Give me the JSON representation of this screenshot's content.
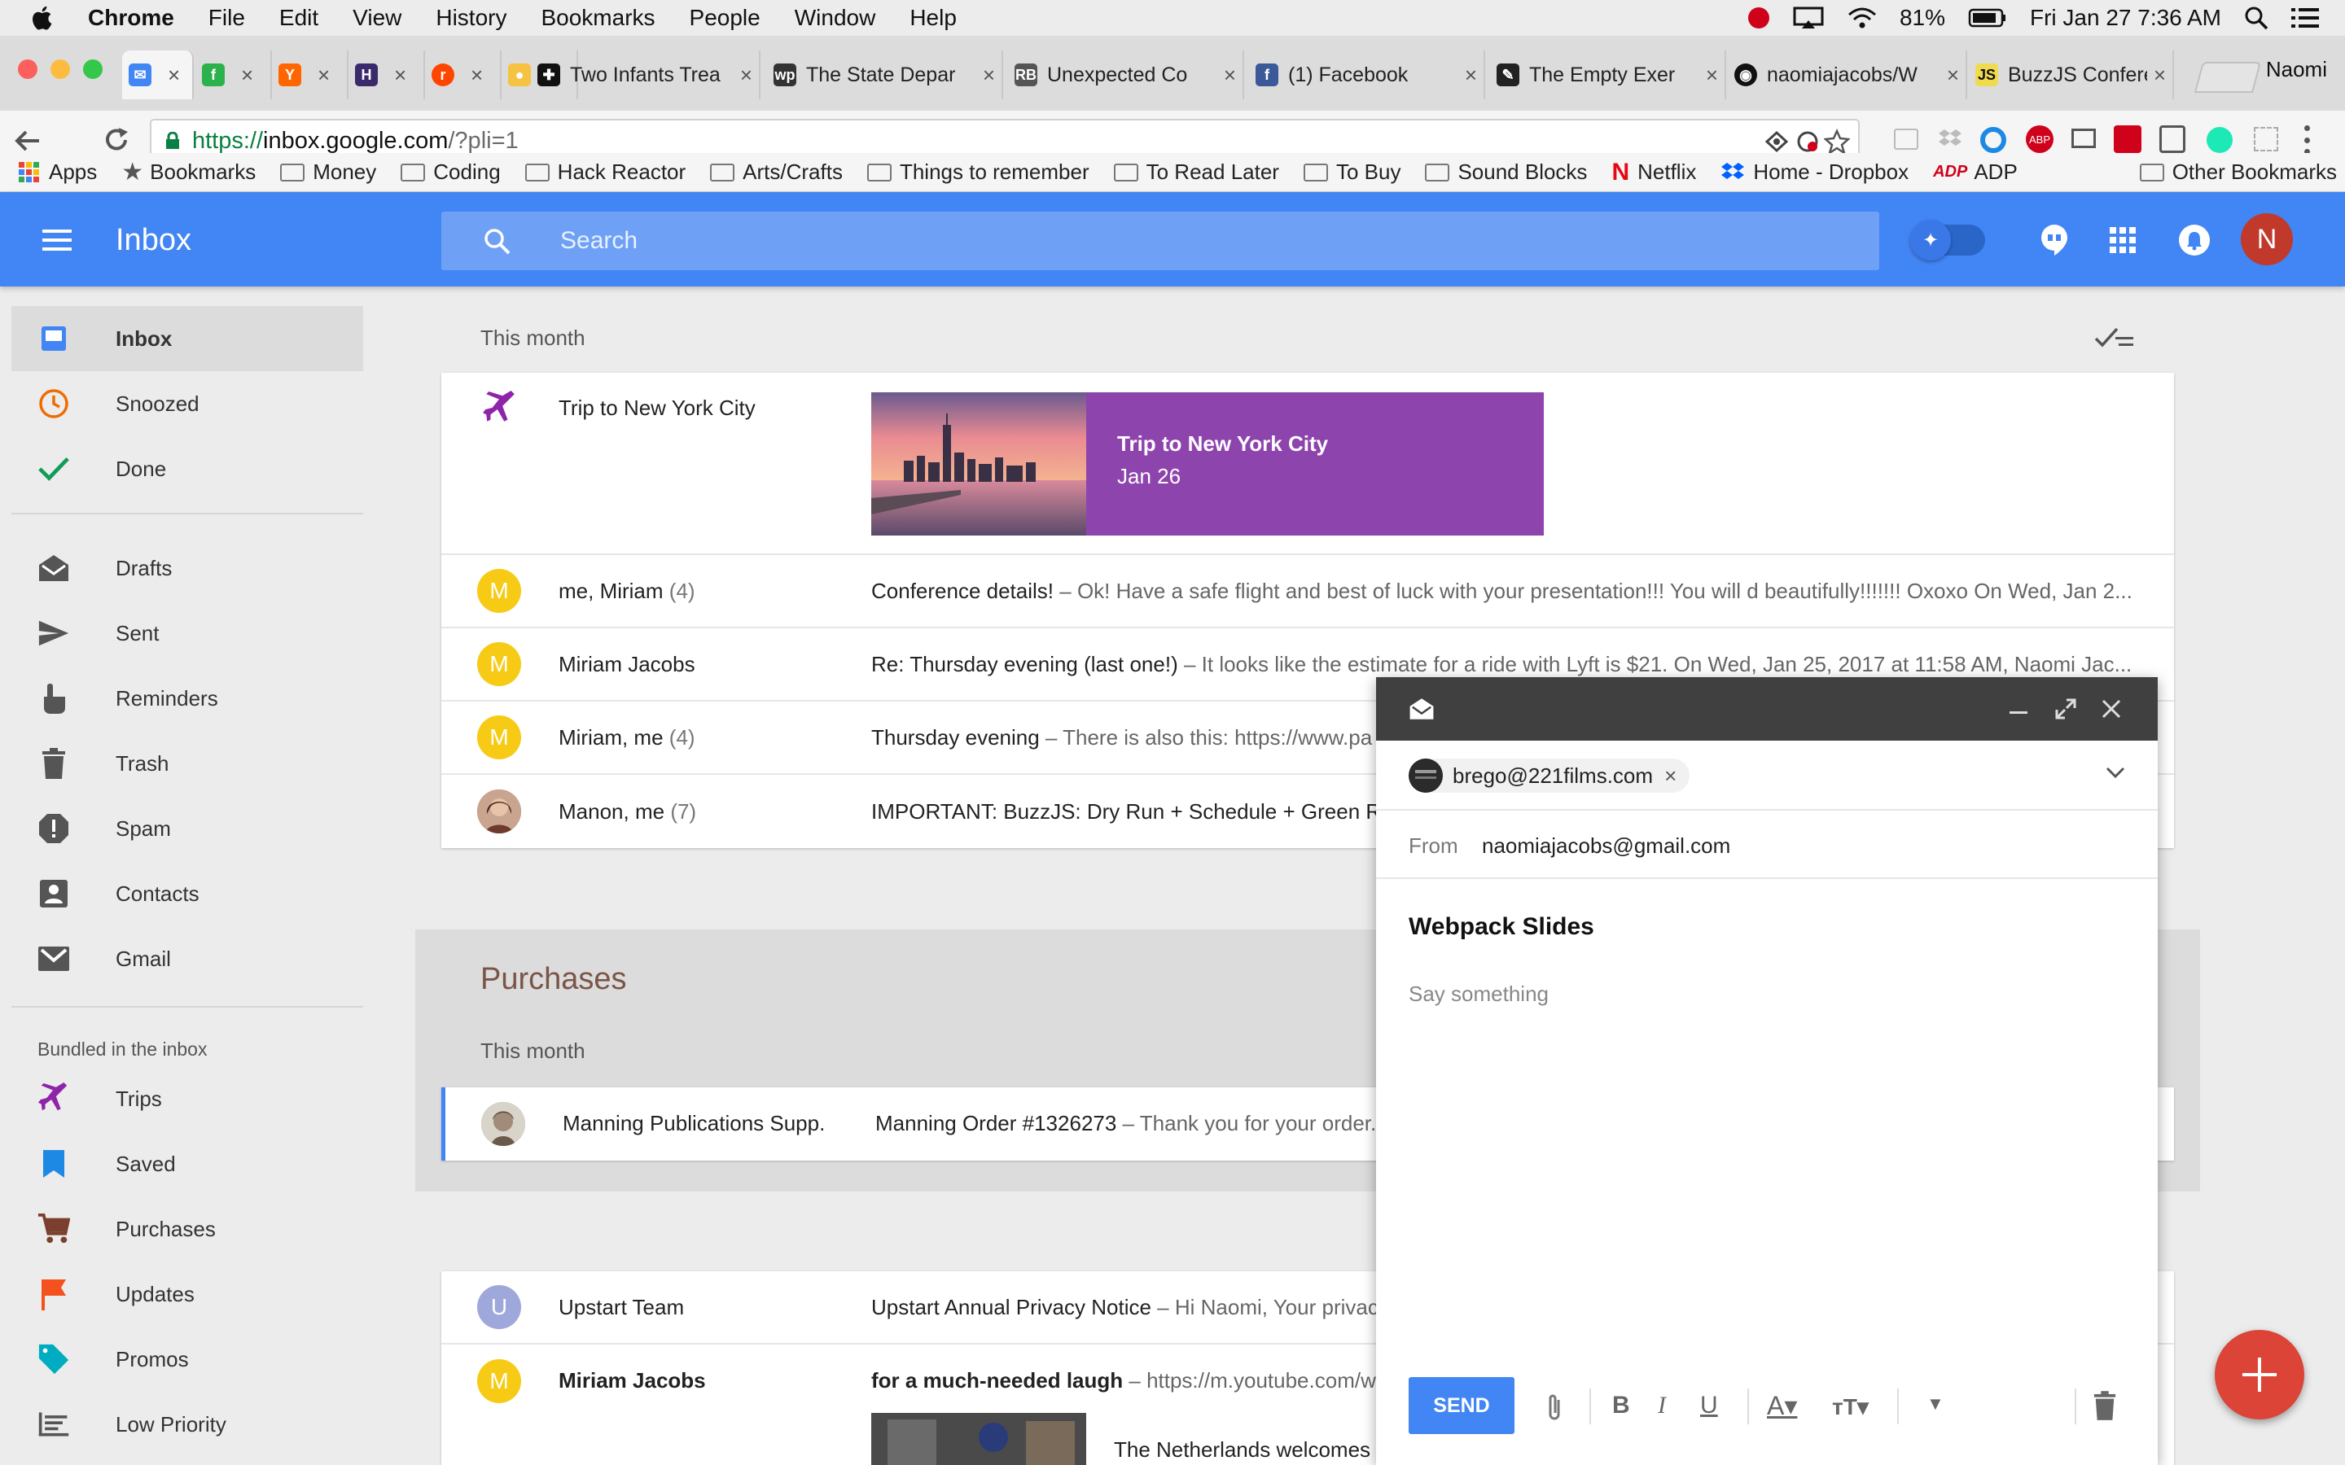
{
  "menubar": {
    "app_name": "Chrome",
    "items": [
      "File",
      "Edit",
      "View",
      "History",
      "Bookmarks",
      "People",
      "Window",
      "Help"
    ],
    "battery": "81%",
    "datetime": "Fri Jan 27  7:36 AM"
  },
  "tabs": [
    {
      "title": "",
      "favicon": "inbox-icon",
      "color": "#4285f4"
    },
    {
      "title": "",
      "favicon": "feedly-icon",
      "color": "#2bb24c"
    },
    {
      "title": "",
      "favicon": "ycombinator-icon",
      "color": "#ff6600"
    },
    {
      "title": "",
      "favicon": "hackreactor-icon",
      "color": "#3b2a6b"
    },
    {
      "title": "",
      "favicon": "reddit-icon",
      "color": "#ff4500"
    },
    {
      "title": "",
      "favicon": "lightbulb-icon",
      "color": "#f5c242"
    },
    {
      "title": "Two Infants Trea",
      "favicon": "gif-icon",
      "color": "#111111"
    },
    {
      "title": "The State Depar",
      "favicon": "wp-icon",
      "color": "#333333"
    },
    {
      "title": "Unexpected Co",
      "favicon": "rb-icon",
      "color": "#555555"
    },
    {
      "title": "(1) Facebook",
      "favicon": "facebook-icon",
      "color": "#3b5998"
    },
    {
      "title": "The Empty Exer",
      "favicon": "pin-icon",
      "color": "#222222"
    },
    {
      "title": "naomiajacobs/W",
      "favicon": "github-icon",
      "color": "#111111"
    },
    {
      "title": "BuzzJS Confere",
      "favicon": "js-icon",
      "color": "#f0db4f"
    }
  ],
  "profile_name": "Naomi",
  "address": {
    "scheme": "https://",
    "domain": "inbox.google.com",
    "path": "/?pli=1"
  },
  "bookmarks": [
    {
      "label": "Apps",
      "icon": "apps-grid-icon"
    },
    {
      "label": "Bookmarks",
      "icon": "star-icon"
    },
    {
      "label": "Money",
      "icon": "folder-icon"
    },
    {
      "label": "Coding",
      "icon": "folder-icon"
    },
    {
      "label": "Hack Reactor",
      "icon": "folder-icon"
    },
    {
      "label": "Arts/Crafts",
      "icon": "folder-icon"
    },
    {
      "label": "Things to remember",
      "icon": "folder-icon"
    },
    {
      "label": "To Read Later",
      "icon": "folder-icon"
    },
    {
      "label": "To Buy",
      "icon": "folder-icon"
    },
    {
      "label": "Sound Blocks",
      "icon": "folder-icon"
    },
    {
      "label": "Netflix",
      "icon": "netflix-icon"
    },
    {
      "label": "Home - Dropbox",
      "icon": "dropbox-icon"
    },
    {
      "label": "ADP",
      "icon": "adp-icon"
    }
  ],
  "other_bookmarks": "Other Bookmarks",
  "header": {
    "title": "Inbox",
    "search_placeholder": "Search",
    "avatar_letter": "N"
  },
  "sidebar": {
    "main_items": [
      {
        "label": "Inbox",
        "icon": "inbox-icon"
      },
      {
        "label": "Snoozed",
        "icon": "clock-icon"
      },
      {
        "label": "Done",
        "icon": "check-icon"
      }
    ],
    "folder_items": [
      {
        "label": "Drafts",
        "icon": "drafts-icon"
      },
      {
        "label": "Sent",
        "icon": "send-icon"
      },
      {
        "label": "Reminders",
        "icon": "reminder-hand-icon"
      },
      {
        "label": "Trash",
        "icon": "trash-icon"
      },
      {
        "label": "Spam",
        "icon": "spam-icon"
      },
      {
        "label": "Contacts",
        "icon": "contacts-icon"
      },
      {
        "label": "Gmail",
        "icon": "gmail-icon"
      }
    ],
    "bundled_title": "Bundled in the inbox",
    "bundle_items": [
      {
        "label": "Trips",
        "icon": "plane-icon"
      },
      {
        "label": "Saved",
        "icon": "bookmark-icon"
      },
      {
        "label": "Purchases",
        "icon": "cart-icon"
      },
      {
        "label": "Updates",
        "icon": "flag-icon"
      },
      {
        "label": "Promos",
        "icon": "tag-icon"
      },
      {
        "label": "Low Priority",
        "icon": "low-priority-icon"
      }
    ]
  },
  "main": {
    "section1_label": "This month",
    "trip": {
      "sender": "Trip to New York City",
      "card_title": "Trip to New York City",
      "card_date": "Jan 26"
    },
    "emails": [
      {
        "avatar": "M",
        "sender": "me, Miriam",
        "count": "(4)",
        "subject": "Conference details!",
        "snippet": " – Ok! Have a safe flight and best of luck with your presentation!!! You will d beautifully!!!!!!! Oxoxo On Wed, Jan 2..."
      },
      {
        "avatar": "M",
        "sender": "Miriam Jacobs",
        "count": "",
        "subject": "Re: Thursday evening (last one!)",
        "snippet": " – It looks like the estimate for a ride with Lyft is $21. On Wed, Jan 25, 2017 at 11:58 AM, Naomi Jac..."
      },
      {
        "avatar": "M",
        "sender": "Miriam, me",
        "count": "(4)",
        "subject": "Thursday evening",
        "snippet": " – There is also this: https://www.pa"
      },
      {
        "avatar": "",
        "sender": "Manon, me",
        "count": "(7)",
        "subject": "IMPORTANT: BuzzJS: Dry Run + Schedule + Green Roo",
        "snippet": ""
      }
    ],
    "purchases": {
      "title": "Purchases",
      "label": "This month",
      "email": {
        "sender": "Manning Publications Supp.",
        "subject": "Manning Order #1326273",
        "snippet": " – Thank you for your order."
      }
    },
    "lower_emails": [
      {
        "avatar": "U",
        "sender": "Upstart Team",
        "subject": "Upstart Annual Privacy Notice",
        "snippet": " – Hi Naomi, Your privac"
      },
      {
        "avatar": "M",
        "sender": "Miriam Jacobs",
        "subject": "for a much-needed laugh",
        "snippet": " – https://m.youtube.com/w"
      }
    ],
    "video_caption": "The Netherlands welcomes T"
  },
  "compose": {
    "recipient": "brego@221films.com",
    "from_label": "From",
    "from_value": "naomiajacobs@gmail.com",
    "subject": "Webpack Slides",
    "body_placeholder": "Say something",
    "send_label": "SEND"
  },
  "colors": {
    "primary": "#4285f4",
    "fab": "#db4437",
    "trip_purple": "#8e44ad",
    "avatar_yellow": "#f7cb15",
    "upstart_avatar": "#9fa8da"
  }
}
